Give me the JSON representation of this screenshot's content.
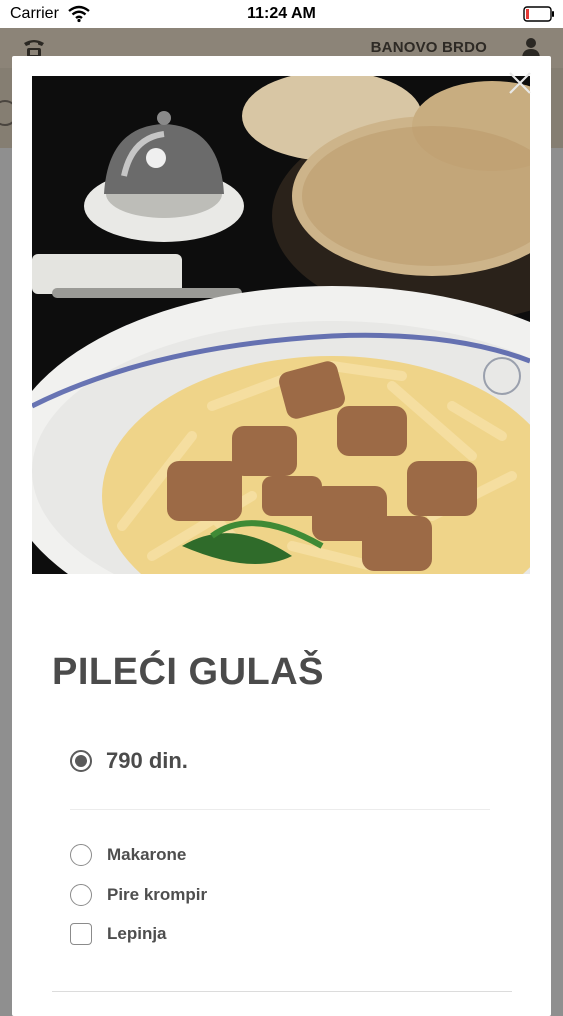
{
  "status_bar": {
    "carrier": "Carrier",
    "time": "11:24 AM"
  },
  "header": {
    "location": "BANOVO BRDO"
  },
  "dish": {
    "title": "PILEĆI GULAŠ",
    "price": "790 din.",
    "price_selected": true,
    "side_options": [
      {
        "label": "Makarone",
        "type": "radio",
        "selected": false
      },
      {
        "label": "Pire krompir",
        "type": "radio",
        "selected": false
      }
    ],
    "extras": [
      {
        "label": "Lepinja",
        "type": "checkbox",
        "checked": false
      }
    ]
  },
  "icons": {
    "status": [
      "wifi-icon",
      "battery-icon"
    ],
    "header": [
      "phone-icon",
      "user-icon"
    ],
    "modal": [
      "close-icon"
    ]
  },
  "colors": {
    "header_bg": "#8c8478",
    "overlay": "#8f8f8f",
    "text": "#4b4b4b"
  }
}
